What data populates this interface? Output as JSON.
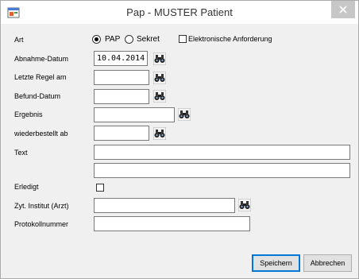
{
  "window": {
    "title": "Pap - MUSTER Patient"
  },
  "form": {
    "art": {
      "label": "Art",
      "options": [
        {
          "label": "PAP",
          "selected": true
        },
        {
          "label": "Sekret",
          "selected": false
        }
      ],
      "electronic_request": {
        "label": "Elektronische Anforderung",
        "checked": false
      }
    },
    "fields": {
      "abnahme_datum": {
        "label": "Abnahme-Datum",
        "value": "10.04.2014"
      },
      "letzte_regel": {
        "label": "Letzte Regel am",
        "value": ""
      },
      "befund_datum": {
        "label": "Befund-Datum",
        "value": ""
      },
      "ergebnis": {
        "label": "Ergebnis",
        "value": ""
      },
      "wiederbestellt": {
        "label": "wiederbestellt ab",
        "value": ""
      },
      "text": {
        "label": "Text",
        "line1": "",
        "line2": ""
      },
      "erledigt": {
        "label": "Erledigt",
        "checked": false
      },
      "institut": {
        "label": "Zyt. Institut (Arzt)",
        "value": ""
      },
      "protokoll": {
        "label": "Protokollnummer",
        "value": ""
      }
    }
  },
  "buttons": {
    "save": "Speichern",
    "cancel": "Abbrechen"
  }
}
